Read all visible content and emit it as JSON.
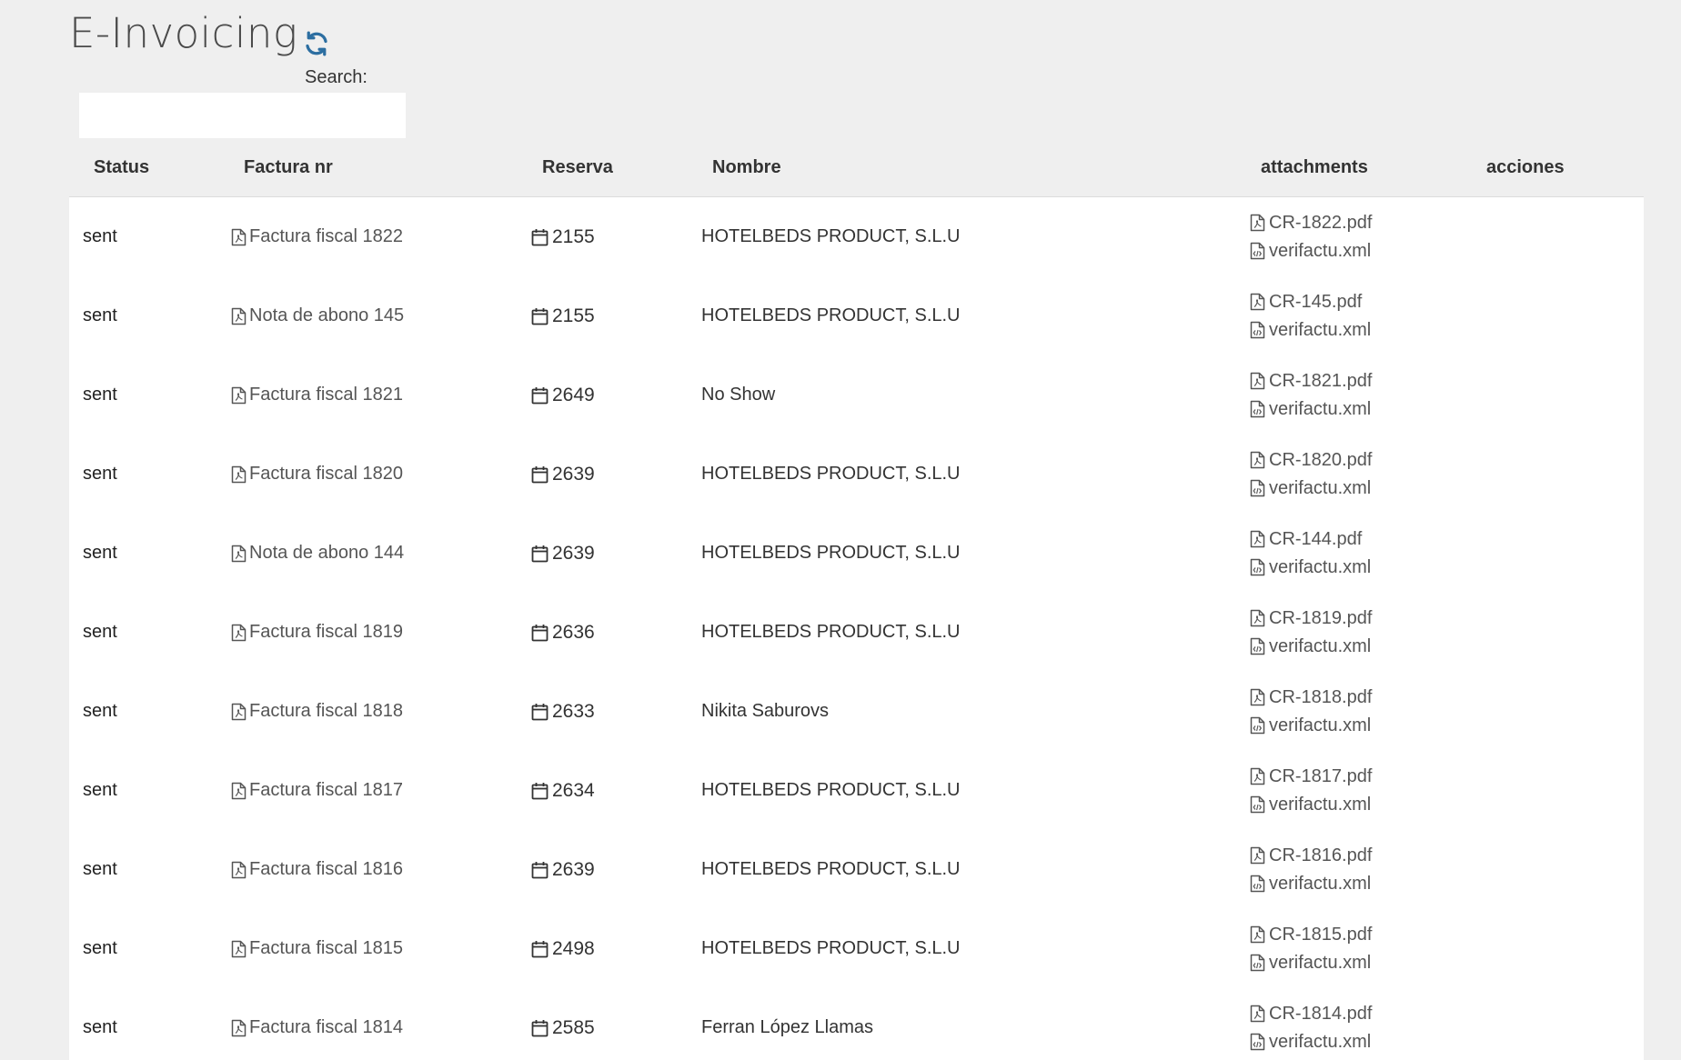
{
  "page": {
    "title": "E-Invoicing"
  },
  "search": {
    "label": "Search:",
    "value": "",
    "placeholder": ""
  },
  "table": {
    "columns": {
      "status": "Status",
      "factura": "Factura nr",
      "reserva": "Reserva",
      "nombre": "Nombre",
      "attachments": "attachments",
      "acciones": "acciones"
    },
    "rows": [
      {
        "status": "sent",
        "factura": "Factura fiscal 1822",
        "reserva": "2155",
        "nombre": "HOTELBEDS PRODUCT, S.L.U",
        "pdf": "CR-1822.pdf",
        "xml": "verifactu.xml"
      },
      {
        "status": "sent",
        "factura": "Nota de abono 145",
        "reserva": "2155",
        "nombre": "HOTELBEDS PRODUCT, S.L.U",
        "pdf": "CR-145.pdf",
        "xml": "verifactu.xml"
      },
      {
        "status": "sent",
        "factura": "Factura fiscal 1821",
        "reserva": "2649",
        "nombre": "No Show",
        "pdf": "CR-1821.pdf",
        "xml": "verifactu.xml"
      },
      {
        "status": "sent",
        "factura": "Factura fiscal 1820",
        "reserva": "2639",
        "nombre": "HOTELBEDS PRODUCT, S.L.U",
        "pdf": "CR-1820.pdf",
        "xml": "verifactu.xml"
      },
      {
        "status": "sent",
        "factura": "Nota de abono 144",
        "reserva": "2639",
        "nombre": "HOTELBEDS PRODUCT, S.L.U",
        "pdf": "CR-144.pdf",
        "xml": "verifactu.xml"
      },
      {
        "status": "sent",
        "factura": "Factura fiscal 1819",
        "reserva": "2636",
        "nombre": "HOTELBEDS PRODUCT, S.L.U",
        "pdf": "CR-1819.pdf",
        "xml": "verifactu.xml"
      },
      {
        "status": "sent",
        "factura": "Factura fiscal 1818",
        "reserva": "2633",
        "nombre": "Nikita Saburovs",
        "pdf": "CR-1818.pdf",
        "xml": "verifactu.xml"
      },
      {
        "status": "sent",
        "factura": "Factura fiscal 1817",
        "reserva": "2634",
        "nombre": "HOTELBEDS PRODUCT, S.L.U",
        "pdf": "CR-1817.pdf",
        "xml": "verifactu.xml"
      },
      {
        "status": "sent",
        "factura": "Factura fiscal 1816",
        "reserva": "2639",
        "nombre": "HOTELBEDS PRODUCT, S.L.U",
        "pdf": "CR-1816.pdf",
        "xml": "verifactu.xml"
      },
      {
        "status": "sent",
        "factura": "Factura fiscal 1815",
        "reserva": "2498",
        "nombre": "HOTELBEDS PRODUCT, S.L.U",
        "pdf": "CR-1815.pdf",
        "xml": "verifactu.xml"
      },
      {
        "status": "sent",
        "factura": "Factura fiscal 1814",
        "reserva": "2585",
        "nombre": "Ferran López Llamas",
        "pdf": "CR-1814.pdf",
        "xml": "verifactu.xml"
      }
    ]
  },
  "icons": {
    "refresh": "refresh-icon",
    "factura": "file-pdf-icon",
    "reserva": "calendar-icon",
    "pdf": "file-pdf-icon",
    "xml": "file-code-icon"
  },
  "colors": {
    "refresh": "#2c6ea1",
    "background": "#efefef",
    "table_body": "#ffffff"
  }
}
